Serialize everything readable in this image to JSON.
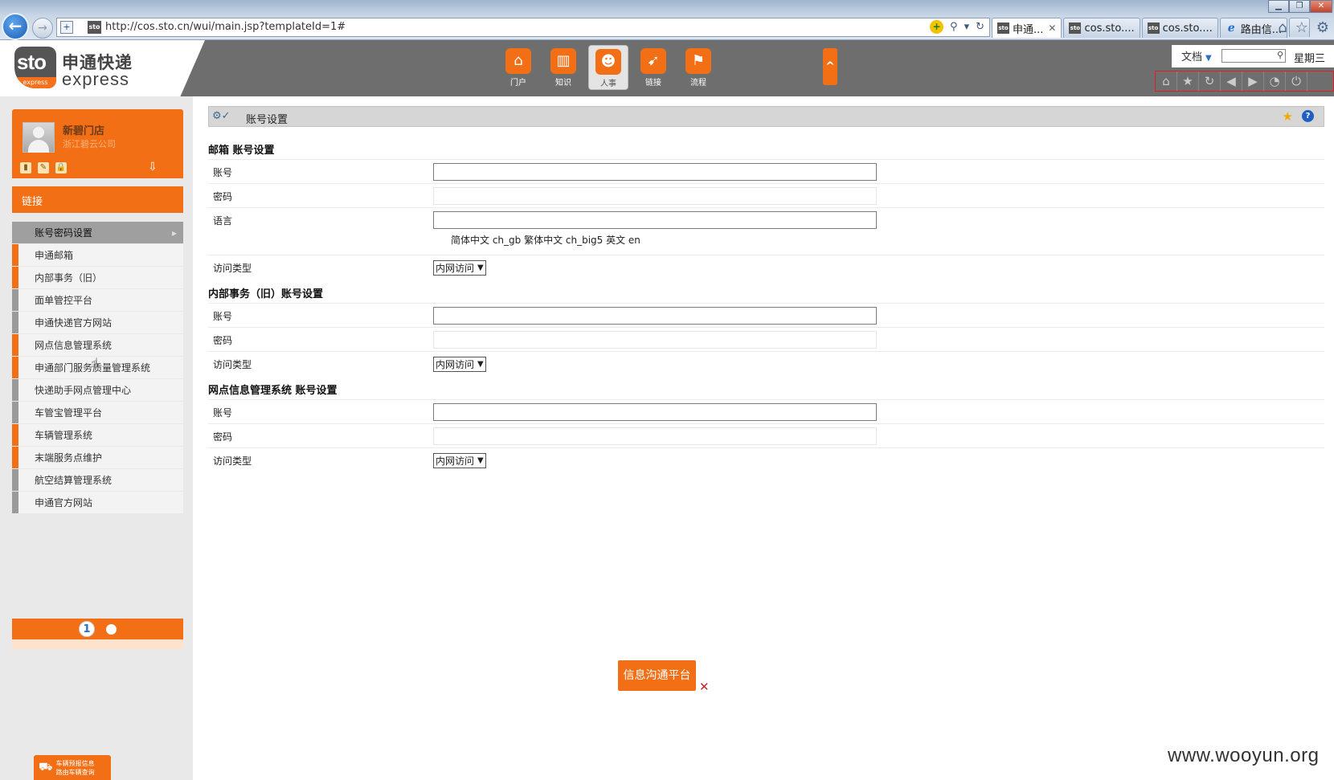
{
  "browser": {
    "url": "http://cos.sto.cn/wui/main.jsp?templateId=1#",
    "tabs": [
      {
        "label": "申通...",
        "active": true
      },
      {
        "label": "cos.sto....",
        "active": false
      },
      {
        "label": "cos.sto....",
        "active": false
      },
      {
        "label": "路由信...",
        "active": false
      }
    ],
    "tab_favicon_text": "sto"
  },
  "header": {
    "logo_badge": "sto",
    "logo_badge_sub": "express",
    "logo_cn": "申通快递",
    "logo_en": "express",
    "nav": [
      {
        "label": "门户",
        "icon": "home-icon",
        "glyph": "⌂",
        "active": false
      },
      {
        "label": "知识",
        "icon": "book-icon",
        "glyph": "▥",
        "active": false
      },
      {
        "label": "人事",
        "icon": "people-icon",
        "glyph": "☻",
        "active": true
      },
      {
        "label": "链接",
        "icon": "cursor-icon",
        "glyph": "➹",
        "active": false
      },
      {
        "label": "流程",
        "icon": "signpost-icon",
        "glyph": "⚑",
        "active": false
      }
    ],
    "collapse_glyph": "^",
    "doc_select": "文档",
    "weekday": "星期三"
  },
  "sidebar": {
    "user_name": "新碧门店",
    "user_company": "浙江碧云公司",
    "links_header": "链接",
    "menu": [
      {
        "label": "账号密码设置",
        "style": "active"
      },
      {
        "label": "申通邮箱",
        "style": "orange"
      },
      {
        "label": "内部事务（旧）",
        "style": "orange"
      },
      {
        "label": "面单管控平台",
        "style": "gray"
      },
      {
        "label": "申通快递官方网站",
        "style": "gray"
      },
      {
        "label": "网点信息管理系统",
        "style": "orange"
      },
      {
        "label": "申通部门服务质量管理系统",
        "style": "orange"
      },
      {
        "label": "快递助手网点管理中心",
        "style": "gray"
      },
      {
        "label": "车管宝管理平台",
        "style": "gray"
      },
      {
        "label": "车辆管理系统",
        "style": "orange"
      },
      {
        "label": "末端服务点维护",
        "style": "orange"
      },
      {
        "label": "航空结算管理系统",
        "style": "gray"
      },
      {
        "label": "申通官方网站",
        "style": "gray"
      }
    ],
    "current_page": "1",
    "vehicle_widget_line1": "车辆预报信息",
    "vehicle_widget_line2": "路由车辆查询"
  },
  "main": {
    "panel_title": "账号设置",
    "sections": [
      {
        "title": "邮箱 账号设置",
        "account_label": "账号",
        "password_label": "密码",
        "language_label": "语言",
        "language_note": "简体中文 ch_gb 繁体中文 ch_big5 英文 en",
        "access_label": "访问类型",
        "access_value": "内网访问"
      },
      {
        "title": "内部事务（旧）账号设置",
        "account_label": "账号",
        "password_label": "密码",
        "access_label": "访问类型",
        "access_value": "内网访问"
      },
      {
        "title": "网点信息管理系统 账号设置",
        "account_label": "账号",
        "password_label": "密码",
        "access_label": "访问类型",
        "access_value": "内网访问"
      }
    ],
    "im_button": "信息沟通平台",
    "watermark": "www.wooyun.org"
  },
  "colors": {
    "brand_orange": "#f36f16",
    "header_gray": "#6e6e6e",
    "sidebar_bg": "#e9e9e9"
  }
}
